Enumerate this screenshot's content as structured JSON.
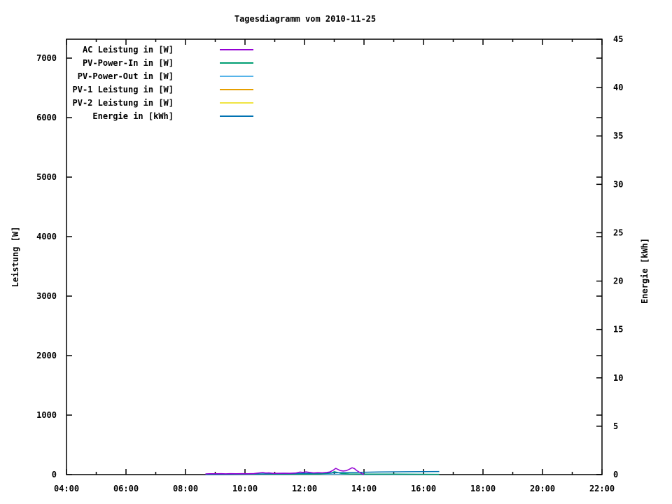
{
  "title": "Tagesdiagramm vom 2010-11-25",
  "axes": {
    "y_label": "Leistung [W]",
    "y2_label": "Energie [kWh]",
    "y_ticks": [
      0,
      1000,
      2000,
      3000,
      4000,
      5000,
      6000,
      7000
    ],
    "y2_ticks": [
      0,
      5,
      10,
      15,
      20,
      25,
      30,
      35,
      40,
      45
    ],
    "x_major_ticks": [
      {
        "hour": 4,
        "label": "04:00"
      },
      {
        "hour": 6,
        "label": "06:00"
      },
      {
        "hour": 8,
        "label": "08:00"
      },
      {
        "hour": 10,
        "label": "10:00"
      },
      {
        "hour": 12,
        "label": "12:00"
      },
      {
        "hour": 14,
        "label": "14:00"
      },
      {
        "hour": 16,
        "label": "16:00"
      },
      {
        "hour": 18,
        "label": "18:00"
      },
      {
        "hour": 20,
        "label": "20:00"
      },
      {
        "hour": 22,
        "label": "22:00"
      }
    ],
    "x_minor_hours": [
      5,
      7,
      9,
      11,
      13,
      15,
      17,
      19,
      21
    ],
    "xlim_hours": [
      4,
      22
    ],
    "ylim": [
      0,
      7318
    ],
    "y2lim": [
      0,
      45
    ],
    "grid": "off",
    "legend_position": "inside-top-left"
  },
  "legend": [
    {
      "label": "AC Leistung in [W]",
      "color": "#9400d3"
    },
    {
      "label": "PV-Power-In in [W]",
      "color": "#009e73"
    },
    {
      "label": "PV-Power-Out in [W]",
      "color": "#56b4e9"
    },
    {
      "label": "PV-1 Leistung in [W]",
      "color": "#e69f00"
    },
    {
      "label": "PV-2 Leistung in [W]",
      "color": "#f0e442"
    },
    {
      "label": "Energie in [kWh]",
      "color": "#0072b2"
    }
  ],
  "chart_data": {
    "type": "line",
    "x_unit": "time of day (decimal hours)",
    "note": "All series start ~08:40 and end ~16:30; values are tiny relative to axis ranges (overcast November day). AC peaks ~105-115 W around 13:00-13:40. Energie reaches only ~0.3 kWh.",
    "series": [
      {
        "name": "PV-2 Leistung in [W]",
        "color": "#f0e442",
        "axis": "left",
        "points": [
          [
            8.67,
            2
          ],
          [
            12.0,
            2
          ],
          [
            16.53,
            2
          ]
        ]
      },
      {
        "name": "PV-1 Leistung in [W]",
        "color": "#e69f00",
        "axis": "left",
        "points": [
          [
            8.67,
            3
          ],
          [
            12.0,
            3
          ],
          [
            16.53,
            3
          ]
        ]
      },
      {
        "name": "PV-Power-Out in [W]",
        "color": "#56b4e9",
        "axis": "left",
        "points": [
          [
            8.67,
            5
          ],
          [
            10.0,
            5
          ],
          [
            12.0,
            5
          ],
          [
            14.0,
            4
          ],
          [
            16.53,
            4
          ]
        ]
      },
      {
        "name": "PV-Power-In in [W]",
        "color": "#009e73",
        "axis": "left",
        "points": [
          [
            8.67,
            8
          ],
          [
            9.5,
            9
          ],
          [
            10.5,
            10
          ],
          [
            11.5,
            10
          ],
          [
            12.5,
            11
          ],
          [
            12.9,
            25
          ],
          [
            13.0,
            50
          ],
          [
            13.1,
            38
          ],
          [
            13.25,
            18
          ],
          [
            13.5,
            12
          ],
          [
            14.0,
            10
          ],
          [
            15.0,
            8
          ],
          [
            16.0,
            6
          ],
          [
            16.53,
            5
          ]
        ]
      },
      {
        "name": "Energie in [kWh]",
        "color": "#0072b2",
        "axis": "right",
        "points": [
          [
            8.67,
            0.01
          ],
          [
            9.5,
            0.03
          ],
          [
            10.5,
            0.07
          ],
          [
            11.5,
            0.1
          ],
          [
            12.5,
            0.15
          ],
          [
            13.5,
            0.22
          ],
          [
            14.5,
            0.27
          ],
          [
            15.5,
            0.3
          ],
          [
            16.53,
            0.32
          ]
        ]
      },
      {
        "name": "AC Leistung in [W]",
        "color": "#9400d3",
        "axis": "left",
        "points": [
          [
            8.67,
            12
          ],
          [
            8.8,
            15
          ],
          [
            9.0,
            14
          ],
          [
            9.2,
            16
          ],
          [
            9.35,
            13
          ],
          [
            9.5,
            16
          ],
          [
            9.7,
            15
          ],
          [
            9.9,
            17
          ],
          [
            10.1,
            15
          ],
          [
            10.3,
            18
          ],
          [
            10.5,
            30
          ],
          [
            10.6,
            34
          ],
          [
            10.7,
            26
          ],
          [
            10.8,
            30
          ],
          [
            10.95,
            20
          ],
          [
            11.1,
            22
          ],
          [
            11.3,
            24
          ],
          [
            11.5,
            22
          ],
          [
            11.7,
            26
          ],
          [
            11.85,
            42
          ],
          [
            11.95,
            36
          ],
          [
            12.05,
            46
          ],
          [
            12.15,
            38
          ],
          [
            12.3,
            28
          ],
          [
            12.45,
            32
          ],
          [
            12.6,
            30
          ],
          [
            12.75,
            36
          ],
          [
            12.85,
            45
          ],
          [
            12.95,
            70
          ],
          [
            13.05,
            105
          ],
          [
            13.12,
            88
          ],
          [
            13.2,
            68
          ],
          [
            13.3,
            60
          ],
          [
            13.4,
            66
          ],
          [
            13.5,
            88
          ],
          [
            13.6,
            115
          ],
          [
            13.68,
            100
          ],
          [
            13.75,
            70
          ],
          [
            13.85,
            40
          ],
          [
            13.95,
            12
          ],
          [
            14.0,
            3
          ]
        ]
      }
    ]
  }
}
